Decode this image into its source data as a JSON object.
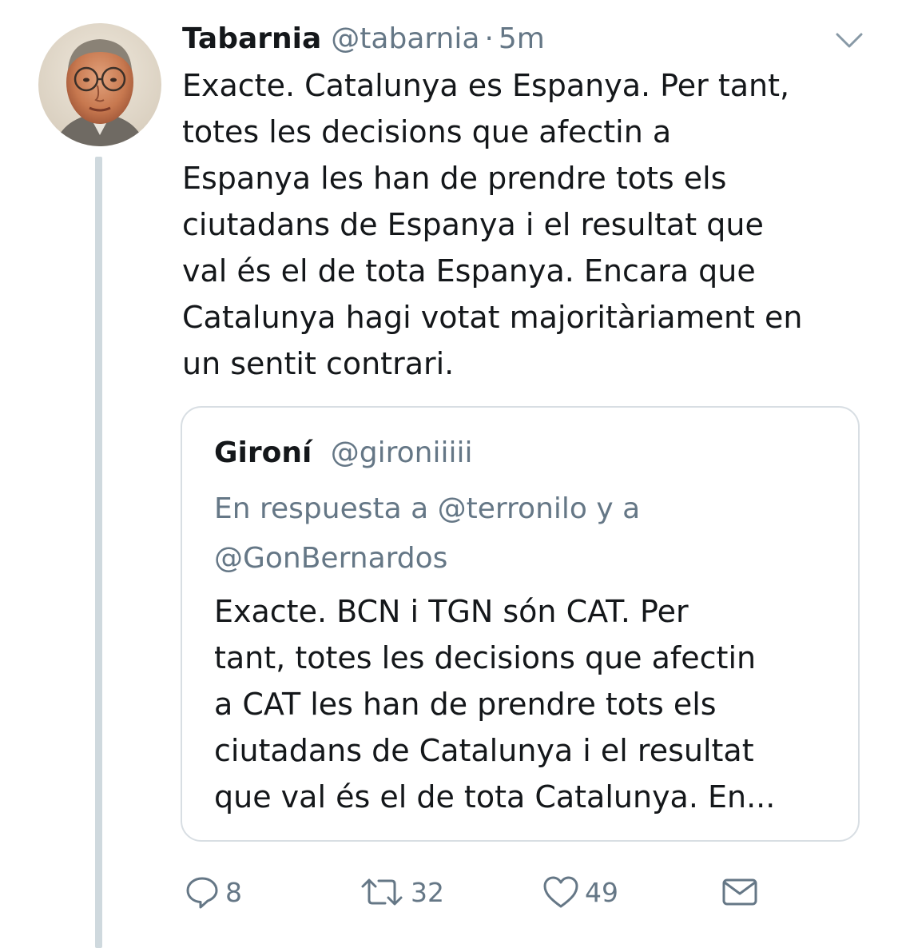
{
  "tweet": {
    "author_name": "Tabarnia",
    "author_handle": "@tabarnia",
    "separator": "·",
    "time": "5m",
    "menu_icon": "chevron-down-icon",
    "text_lines": [
      "Exacte. Catalunya es Espanya. Per tant,",
      "totes les decisions que afectin a",
      "Espanya les han de prendre tots els",
      "ciutadans de Espanya i el resultat que",
      "val és el de tota Espanya. Encara que",
      "Catalunya hagi votat majoritàriament en",
      "un sentit contrari."
    ]
  },
  "quoted_tweet": {
    "author_name": "Gironí",
    "author_handle": "@gironiiiii",
    "reply_lines": [
      "En respuesta a @terronilo y a",
      "@GonBernardos"
    ],
    "text_lines": [
      "Exacte. BCN i TGN són CAT. Per",
      "tant, totes les decisions que afectin",
      "a CAT les han de prendre tots els",
      "ciutadans de Catalunya i el resultat",
      "que val és el de tota Catalunya. En..."
    ]
  },
  "actions": {
    "reply": {
      "icon": "reply-icon",
      "count": "8"
    },
    "retweet": {
      "icon": "retweet-icon",
      "count": "32"
    },
    "like": {
      "icon": "heart-icon",
      "count": "49"
    },
    "message": {
      "icon": "envelope-icon"
    }
  },
  "colors": {
    "text": "#14171a",
    "secondary": "#657786",
    "thread_line": "#cfd9de",
    "border": "#d8dee3"
  }
}
